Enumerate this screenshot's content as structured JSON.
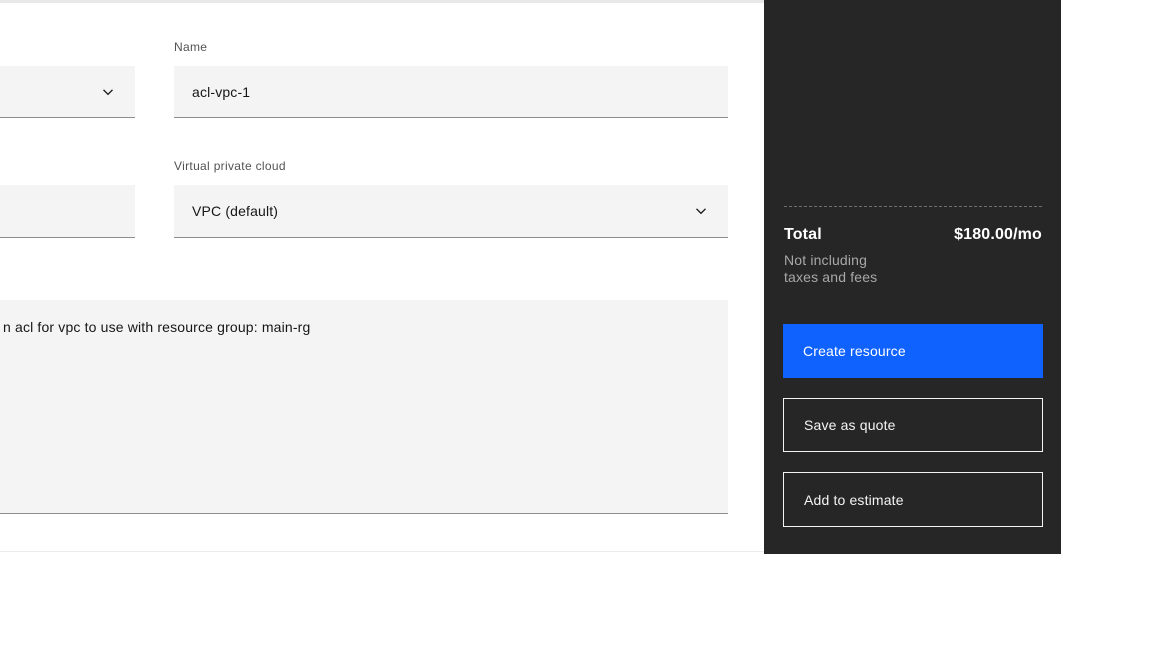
{
  "colors": {
    "accent": "#0f62fe",
    "panel": "#262626",
    "field": "#f4f4f4",
    "fieldline": "#8d8d8d",
    "label": "#525252",
    "text": "#161616",
    "muted": "#a8a8a8",
    "btnline": "#f4f4f4",
    "divider": "#6f6f6f",
    "cardline": "#ececec",
    "topstrip": "#e8e8e8"
  },
  "icons": {
    "chevron_down": "chevron-down"
  },
  "form": {
    "name_field": {
      "label": "Name",
      "value": "acl-vpc-1"
    },
    "vpc_field": {
      "label": "Virtual private cloud",
      "value": "VPC (default)"
    },
    "description_field": {
      "value": "n acl for vpc to use with resource group: main-rg"
    }
  },
  "summary": {
    "total_label": "Total",
    "total_value": "$180.00/mo",
    "disclaimer": [
      "Not including",
      "taxes and fees"
    ],
    "buttons": {
      "create": "Create resource",
      "save_quote": "Save as quote",
      "add_estimate": "Add to estimate"
    }
  }
}
